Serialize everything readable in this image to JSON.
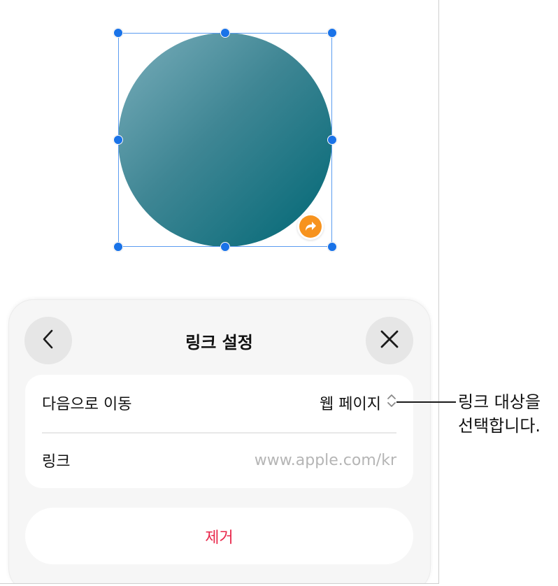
{
  "panel": {
    "title": "링크 설정",
    "rows": [
      {
        "label": "다음으로 이동",
        "value": "웹 페이지"
      },
      {
        "label": "링크",
        "placeholder": "www.apple.com/kr"
      }
    ],
    "remove_label": "제거"
  },
  "callout": {
    "line1": "링크 대상을",
    "line2": "선택합니다."
  },
  "icons": {
    "back": "chevron-left-icon",
    "close": "close-icon",
    "link_badge": "link-arrow-icon",
    "stepper": "up-down-chevron-icon"
  },
  "colors": {
    "handle": "#1a73e8",
    "link_badge": "#f7931e",
    "remove_text": "#e8274b",
    "shape_gradient_start": "#7aaebb",
    "shape_gradient_end": "#006775"
  }
}
